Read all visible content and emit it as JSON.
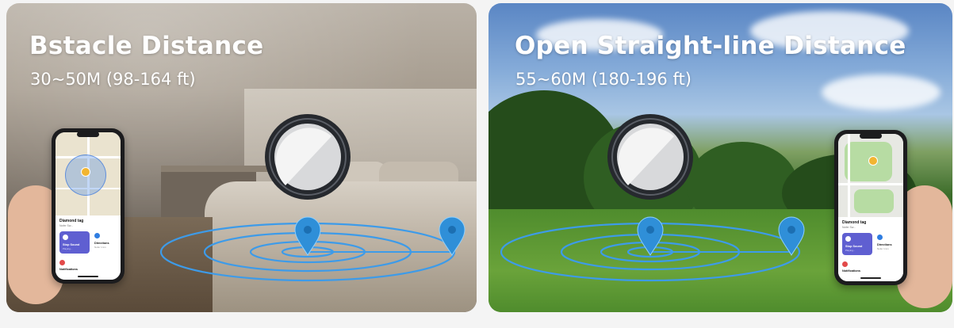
{
  "panels": [
    {
      "title": "Bstacle Distance",
      "subtitle": "30~50M (98-164 ft)",
      "phone": {
        "item_name": "Diamond tag",
        "item_sub": "Nofer Sw...",
        "action_play": "Stop Sound",
        "action_play_sub": "Playing...",
        "action_directions": "Directions",
        "action_directions_sub": "Nofer 1 km",
        "notifications": "Notifications"
      }
    },
    {
      "title": "Open Straight-line Distance",
      "subtitle": "55~60M (180-196 ft)",
      "phone": {
        "item_name": "Diamond tag",
        "item_sub": "Nofer Sw...",
        "action_play": "Stop Sound",
        "action_play_sub": "Playing...",
        "action_directions": "Directions",
        "action_directions_sub": "Nofer 1 km",
        "notifications": "Notifications"
      }
    }
  ],
  "colors": {
    "ring": "#3d9be9",
    "pin": "#2f8fd8",
    "tag_ring": "#2a2d33",
    "tag_face": "#d8d9db"
  },
  "icons": {
    "pin": "location-pin-icon",
    "tag": "tracker-tag-icon",
    "play": "sound-icon",
    "directions": "directions-icon",
    "notifications": "bell-icon"
  }
}
